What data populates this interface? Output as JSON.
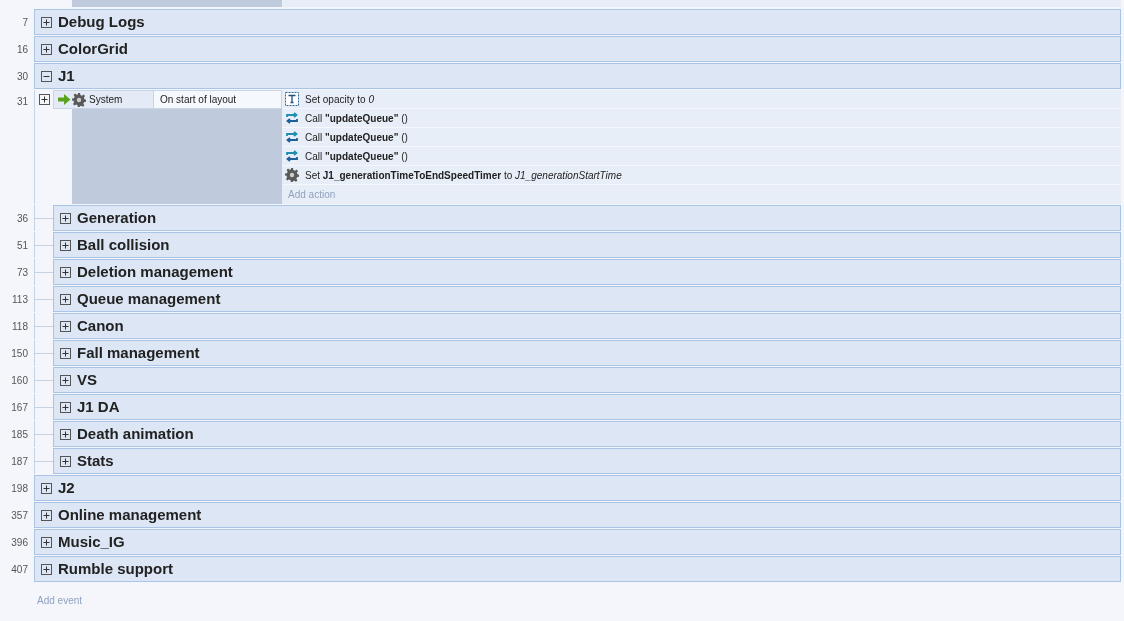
{
  "groups": [
    {
      "line": "7",
      "title": "Debug Logs",
      "expanded": false
    },
    {
      "line": "16",
      "title": "ColorGrid",
      "expanded": false
    },
    {
      "line": "30",
      "title": "J1",
      "expanded": true,
      "events": [
        {
          "line": "31",
          "expanded": false,
          "condition": {
            "object": "System",
            "text": "On start of layout"
          },
          "actions": [
            {
              "kind": "text",
              "text": "Set opacity to *0*"
            },
            {
              "kind": "call",
              "text": "Call **\"updateQueue\"** ()"
            },
            {
              "kind": "call",
              "text": "Call **\"updateQueue\"** ()"
            },
            {
              "kind": "call",
              "text": "Call **\"updateQueue\"** ()"
            },
            {
              "kind": "system",
              "text": "Set **J1_generationTimeToEndSpeedTimer** to *J1_generationStartTime*"
            }
          ],
          "add_action": "Add action"
        }
      ],
      "children": [
        {
          "line": "36",
          "title": "Generation",
          "expanded": false
        },
        {
          "line": "51",
          "title": "Ball collision",
          "expanded": false
        },
        {
          "line": "73",
          "title": "Deletion management",
          "expanded": false
        },
        {
          "line": "113",
          "title": "Queue management",
          "expanded": false
        },
        {
          "line": "118",
          "title": "Canon",
          "expanded": false
        },
        {
          "line": "150",
          "title": "Fall management",
          "expanded": false
        },
        {
          "line": "160",
          "title": "VS",
          "expanded": false
        },
        {
          "line": "167",
          "title": "J1 DA",
          "expanded": false
        },
        {
          "line": "185",
          "title": "Death animation",
          "expanded": false
        },
        {
          "line": "187",
          "title": "Stats",
          "expanded": false
        }
      ]
    },
    {
      "line": "198",
      "title": "J2",
      "expanded": false
    },
    {
      "line": "357",
      "title": "Online management",
      "expanded": false
    },
    {
      "line": "396",
      "title": "Music_IG",
      "expanded": false
    },
    {
      "line": "407",
      "title": "Rumble support",
      "expanded": false
    }
  ],
  "add_event": "Add event"
}
